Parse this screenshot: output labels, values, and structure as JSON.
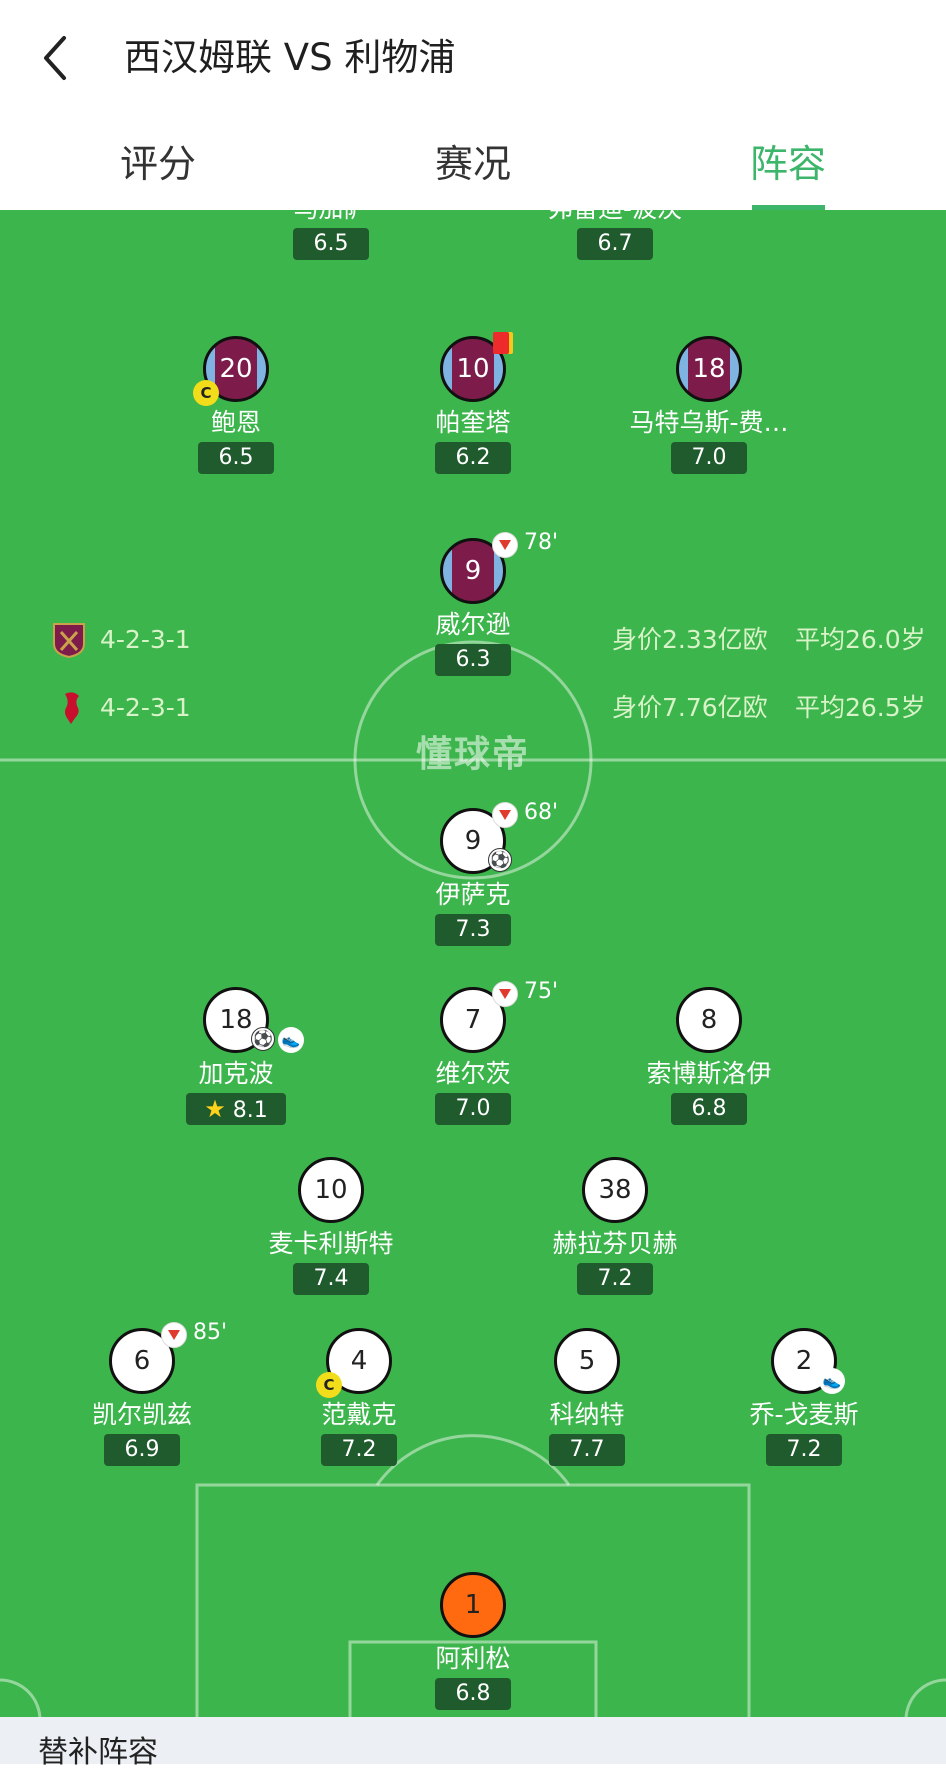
{
  "header": {
    "title": "西汉姆联 VS 利物浦",
    "tabs": [
      {
        "label": "评分"
      },
      {
        "label": "赛况"
      },
      {
        "label": "阵容",
        "active": true
      }
    ]
  },
  "watermark": "懂球帝",
  "home_team": {
    "name": "West Ham",
    "formation": "4-2-3-1",
    "value": "身价2.33亿欧",
    "avg_age": "平均26.0岁",
    "colors": {
      "primary": "#7d1c4a",
      "secondary": "#7fb3e1"
    },
    "players": [
      {
        "name": "马加萨",
        "rating": "6.5"
      },
      {
        "name": "弗雷迪-波茨",
        "rating": "6.7"
      },
      {
        "number": "20",
        "name": "鲍恩",
        "rating": "6.5",
        "captain": "C"
      },
      {
        "number": "10",
        "name": "帕奎塔",
        "rating": "6.2",
        "card": "red"
      },
      {
        "number": "18",
        "name": "马特乌斯-费…",
        "rating": "7.0"
      },
      {
        "number": "9",
        "name": "威尔逊",
        "rating": "6.3",
        "sub_time": "78'"
      }
    ]
  },
  "away_team": {
    "name": "Liverpool",
    "formation": "4-2-3-1",
    "value": "身价7.76亿欧",
    "avg_age": "平均26.5岁",
    "colors": {
      "primary": "#ffffff",
      "gk": "#ff6a10"
    },
    "players": [
      {
        "number": "9",
        "name": "伊萨克",
        "rating": "7.3",
        "sub_time": "68'",
        "goal": true
      },
      {
        "number": "18",
        "name": "加克波",
        "rating": "8.1",
        "goal": true,
        "assist": true,
        "mvp": true
      },
      {
        "number": "7",
        "name": "维尔茨",
        "rating": "7.0",
        "sub_time": "75'"
      },
      {
        "number": "8",
        "name": "索博斯洛伊",
        "rating": "6.8"
      },
      {
        "number": "10",
        "name": "麦卡利斯特",
        "rating": "7.4"
      },
      {
        "number": "38",
        "name": "赫拉芬贝赫",
        "rating": "7.2"
      },
      {
        "number": "6",
        "name": "凯尔凯兹",
        "rating": "6.9",
        "sub_time": "85'"
      },
      {
        "number": "4",
        "name": "范戴克",
        "rating": "7.2",
        "captain": "C"
      },
      {
        "number": "5",
        "name": "科纳特",
        "rating": "7.7"
      },
      {
        "number": "2",
        "name": "乔-戈麦斯",
        "rating": "7.2",
        "assist": true
      },
      {
        "number": "1",
        "name": "阿利松",
        "rating": "6.8",
        "goalkeeper": true
      }
    ]
  },
  "subs_section": {
    "title": "替补阵容"
  },
  "icons": {
    "back": "chevron-left-icon",
    "sub_off": "substitution-off-icon",
    "goal": "football-icon",
    "assist": "boot-icon",
    "captain": "captain-badge-icon",
    "red_card": "red-card-icon",
    "mvp": "star-icon"
  }
}
